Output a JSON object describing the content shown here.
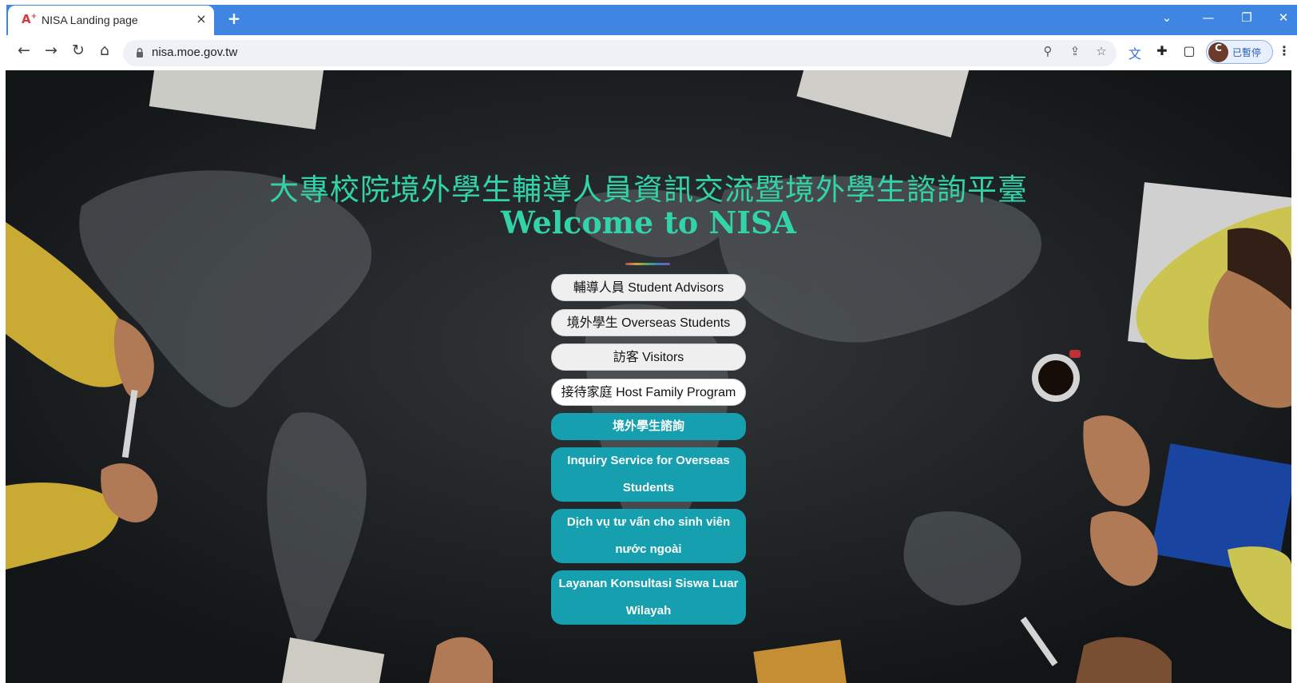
{
  "browser": {
    "tab_title": "NISA Landing page",
    "tab_close_glyph": "×",
    "new_tab_glyph": "+",
    "url": "nisa.moe.gov.tw",
    "profile_initial": "C",
    "profile_label": "已暫停",
    "window_controls": {
      "tab_search": "⌄",
      "minimize": "—",
      "restore": "❐",
      "close": "✕"
    },
    "icons": [
      "back-icon",
      "forward-icon",
      "reload-icon",
      "home-icon",
      "lock-icon",
      "zoom-icon",
      "share-icon",
      "bookmark-star-icon",
      "translate-icon",
      "extensions-icon",
      "side-panel-icon",
      "menu-icon"
    ]
  },
  "page": {
    "title_zh": "大專校院境外學生輔導人員資訊交流暨境外學生諮詢平臺",
    "title_en": "Welcome to NISA",
    "buttons": [
      {
        "label": "輔導人員 Student Advisors"
      },
      {
        "label": "境外學生 Overseas Students"
      },
      {
        "label": "訪客 Visitors"
      },
      {
        "label": "接待家庭 Host Family Program"
      },
      {
        "label": "境外學生諮詢"
      },
      {
        "label": "Inquiry Service for Overseas Students"
      },
      {
        "label": "Dịch vụ tư vấn cho sinh viên nước ngoài"
      },
      {
        "label": "Layanan Konsultasi Siswa Luar Wilayah"
      }
    ]
  },
  "colors": {
    "tabstrip": "#3f86e2",
    "title_accent": "#33d3a9",
    "teal_button": "#169fae",
    "light_button": "#efefef",
    "background": "#1c1f21"
  }
}
